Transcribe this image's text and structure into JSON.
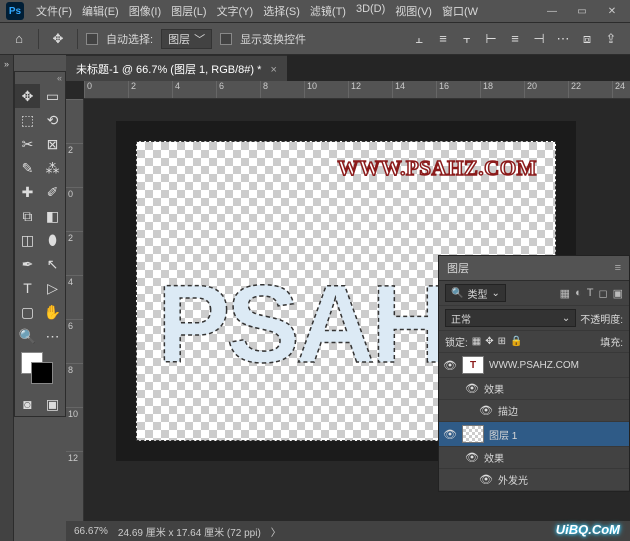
{
  "menu": {
    "items": [
      "文件(F)",
      "编辑(E)",
      "图像(I)",
      "图层(L)",
      "文字(Y)",
      "选择(S)",
      "滤镜(T)",
      "3D(D)",
      "视图(V)",
      "窗口(W"
    ]
  },
  "optionbar": {
    "auto_select": "自动选择:",
    "layer": "图层",
    "show_transform": "显示变换控件"
  },
  "doc": {
    "tab": "未标题-1 @ 66.7% (图层 1, RGB/8#) *",
    "ruler_h": [
      "0",
      "2",
      "4",
      "6",
      "8",
      "10",
      "12",
      "14",
      "16",
      "18",
      "20",
      "22",
      "24"
    ],
    "ruler_v": [
      "",
      "2",
      "0",
      "2",
      "4",
      "6",
      "8",
      "10",
      "12"
    ],
    "url": "WWW.PSAHZ.COM",
    "zoom": "66.67%",
    "dims": "24.69 厘米 x 17.64 厘米 (72 ppi)"
  },
  "panel": {
    "title": "图层",
    "type": "类型",
    "blend": "正常",
    "opacity_label": "不透明度:",
    "lock_label": "锁定:",
    "fill_label": "填充:",
    "layers": [
      {
        "name": "WWW.PSAHZ.COM",
        "type": "text"
      },
      {
        "name": "效果",
        "sub": true
      },
      {
        "name": "描边",
        "sub2": true
      },
      {
        "name": "图层 1",
        "type": "sel"
      },
      {
        "name": "效果",
        "sub": true
      },
      {
        "name": "外发光",
        "sub2": true
      }
    ]
  },
  "watermark": "UiBQ.CoM"
}
